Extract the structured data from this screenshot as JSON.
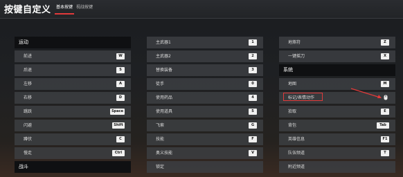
{
  "header": {
    "title": "按键自定义",
    "tabs": [
      {
        "label": "基本按键"
      },
      {
        "label": "视战按键"
      }
    ]
  },
  "col1": {
    "sections": [
      {
        "header": "运动",
        "rows": [
          {
            "label": "前进",
            "key": "W"
          },
          {
            "label": "后退",
            "key": "S"
          },
          {
            "label": "左移",
            "key": "A"
          },
          {
            "label": "右移",
            "key": "D"
          },
          {
            "label": "跳跃",
            "key": "Space"
          },
          {
            "label": "闪避",
            "key": "Shift"
          },
          {
            "label": "蹲伏",
            "key": "C"
          },
          {
            "label": "慢走",
            "key": "Ctrl"
          }
        ]
      },
      {
        "header": "战斗",
        "rows": []
      }
    ]
  },
  "col2": {
    "rows": [
      {
        "label": "主武器1",
        "key": "1"
      },
      {
        "label": "主武器2",
        "key": "2"
      },
      {
        "label": "替换装备",
        "key": "3"
      },
      {
        "label": "徒手",
        "key": "0"
      },
      {
        "label": "使用药品",
        "key": "4"
      },
      {
        "label": "使用道具",
        "key": "5"
      },
      {
        "label": "飞索",
        "key": "G"
      },
      {
        "label": "技能",
        "key": "F"
      },
      {
        "label": "奥义技能",
        "key": "V"
      },
      {
        "label": "锁定",
        "key": ""
      }
    ]
  },
  "col3": {
    "rows_top": [
      {
        "label": "地煞符",
        "key": "Z"
      },
      {
        "label": "一键摇刀",
        "key": "X"
      }
    ],
    "section_header": "系统",
    "rows_bottom": [
      {
        "label": "地图",
        "key": "M"
      },
      {
        "label": "标记/表情动作",
        "key": ""
      },
      {
        "label": "拾取",
        "key": "E"
      },
      {
        "label": "背包",
        "key": "Tab"
      },
      {
        "label": "英雄信息",
        "key": "F1"
      },
      {
        "label": "队伍频道",
        "key": "T"
      },
      {
        "label": "附近频道",
        "key": ""
      }
    ]
  },
  "colors": {
    "accent": "#e23a3a"
  }
}
